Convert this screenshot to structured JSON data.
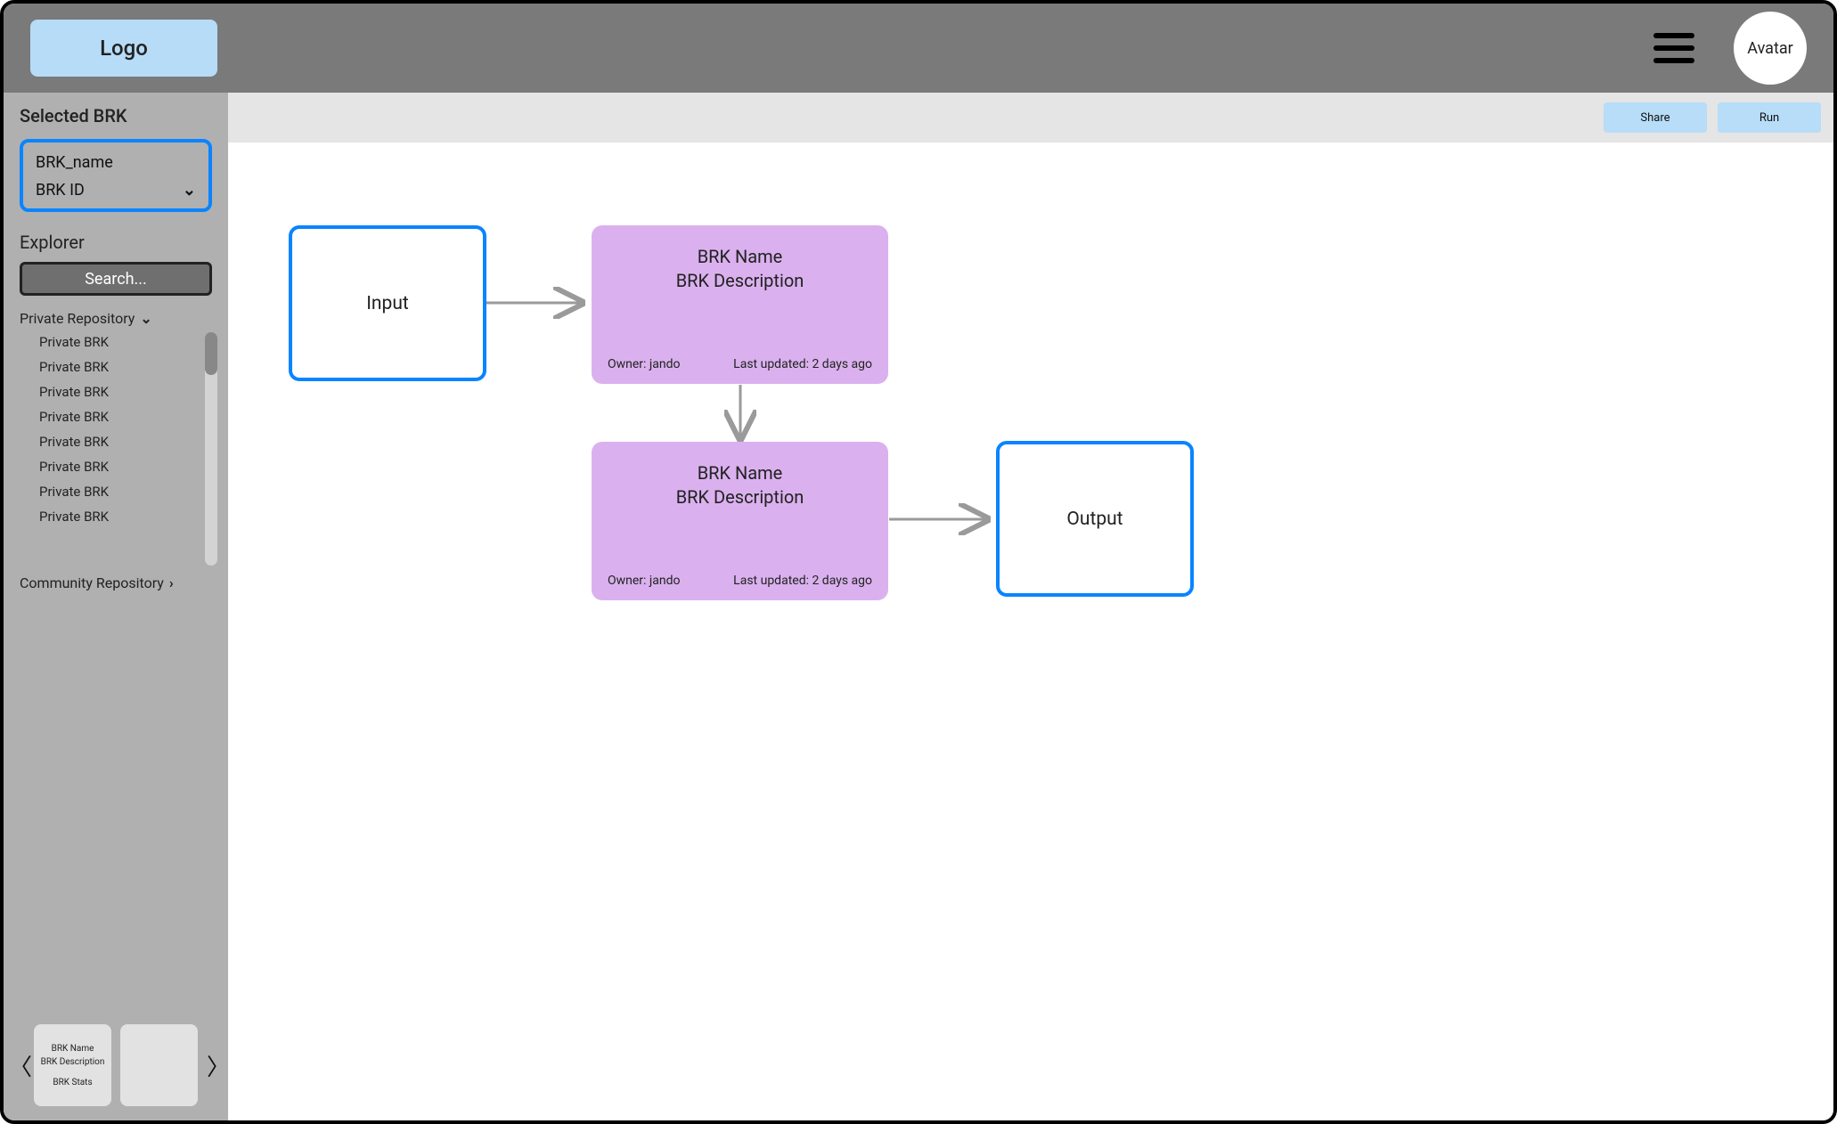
{
  "header": {
    "logo_label": "Logo",
    "avatar_label": "Avatar"
  },
  "sidebar": {
    "selected_title": "Selected BRK",
    "selected": {
      "name": "BRK_name",
      "id": "BRK ID"
    },
    "explorer_title": "Explorer",
    "search_placeholder": "Search...",
    "private_repo_label": "Private Repository",
    "community_repo_label": "Community Repository",
    "private_items": [
      "Private BRK",
      "Private BRK",
      "Private BRK",
      "Private BRK",
      "Private BRK",
      "Private BRK",
      "Private BRK",
      "Private BRK"
    ],
    "carousel": {
      "card_name": "BRK Name",
      "card_desc": "BRK Description",
      "card_stats": "BRK Stats"
    }
  },
  "toolbar": {
    "share_label": "Share",
    "run_label": "Run"
  },
  "canvas": {
    "input_label": "Input",
    "output_label": "Output",
    "brk1": {
      "name": "BRK Name",
      "desc": "BRK Description",
      "owner": "Owner: jando",
      "updated": "Last updated: 2 days ago"
    },
    "brk2": {
      "name": "BRK Name",
      "desc": "BRK Description",
      "owner": "Owner: jando",
      "updated": "Last updated: 2 days ago"
    }
  }
}
